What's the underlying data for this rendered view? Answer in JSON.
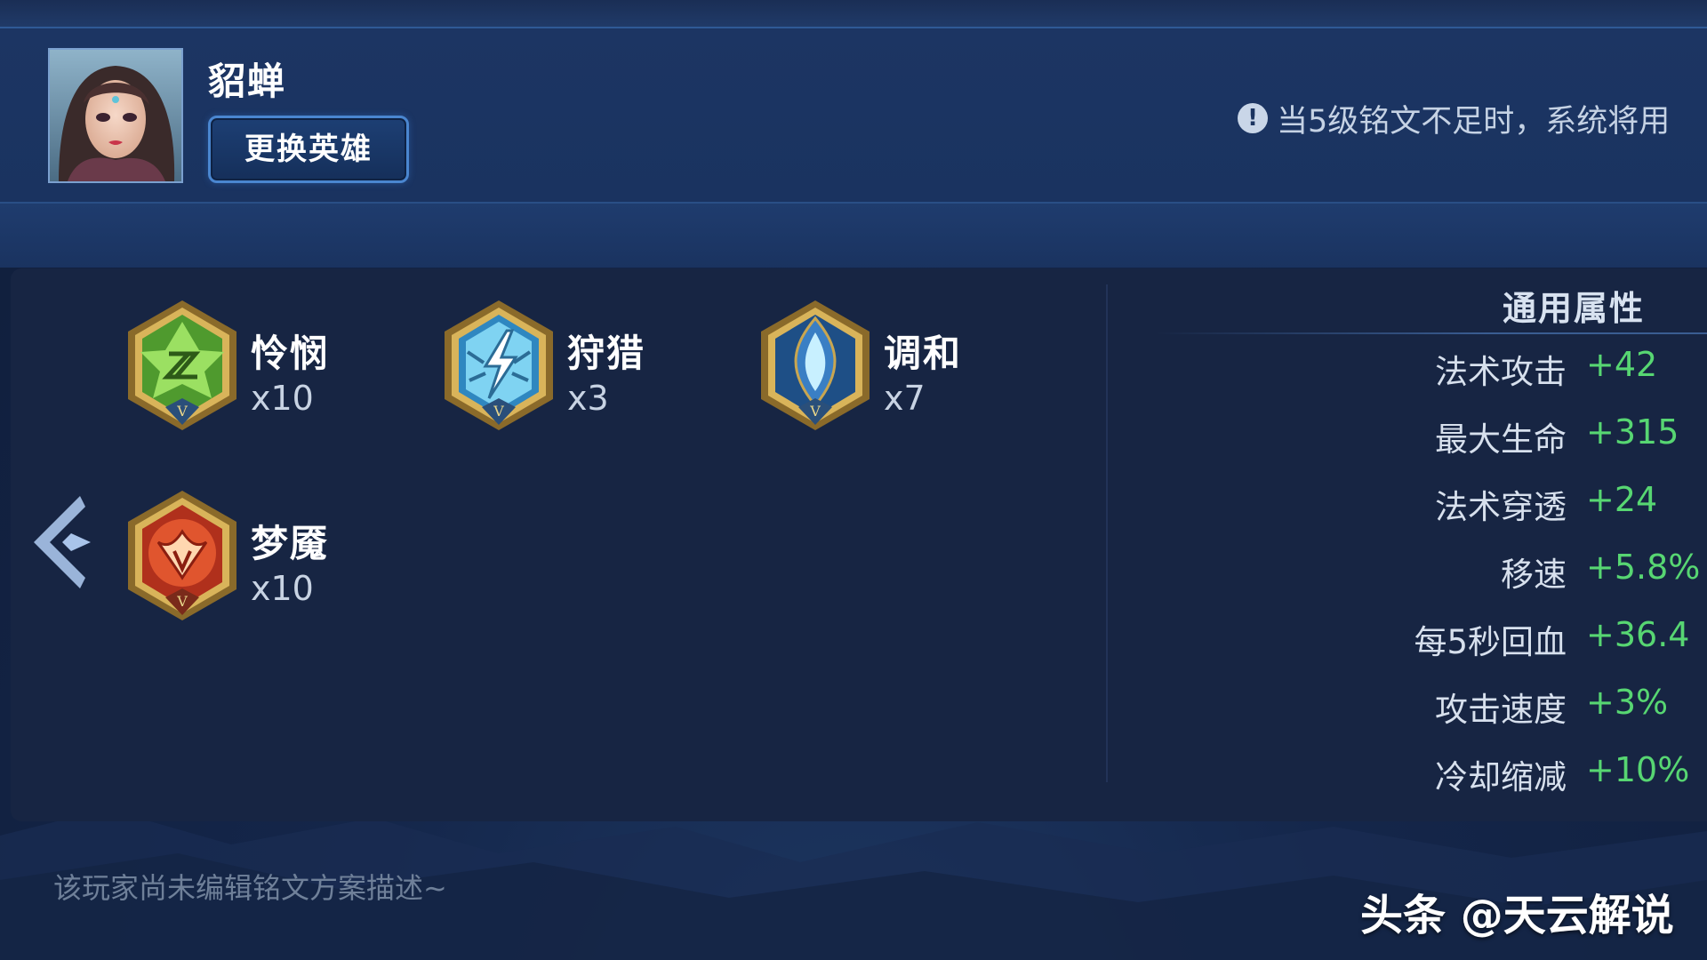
{
  "hero": {
    "name": "貂蝉",
    "change_button_label": "更换英雄"
  },
  "notice": {
    "icon": "exclamation-icon",
    "text": "当5级铭文不足时，系统将用"
  },
  "runes": [
    {
      "name": "怜悯",
      "count": "x10",
      "color": "#6cc24a",
      "icon": "green-rune-icon"
    },
    {
      "name": "狩猎",
      "count": "x3",
      "color": "#3aa7d8",
      "icon": "blue-rune-icon"
    },
    {
      "name": "调和",
      "count": "x7",
      "color": "#3a7fc4",
      "icon": "blue-rune-icon"
    },
    {
      "name": "梦魇",
      "count": "x10",
      "color": "#d7462a",
      "icon": "red-rune-icon"
    }
  ],
  "attributes": {
    "title": "通用属性",
    "items": [
      {
        "label": "法术攻击",
        "value": "+42"
      },
      {
        "label": "最大生命",
        "value": "+315"
      },
      {
        "label": "法术穿透",
        "value": "+24"
      },
      {
        "label": "移速",
        "value": "+5.8%"
      },
      {
        "label": "每5秒回血",
        "value": "+36.4"
      },
      {
        "label": "攻击速度",
        "value": "+3%"
      },
      {
        "label": "冷却缩减",
        "value": "+10%"
      }
    ]
  },
  "description": "该玩家尚未编辑铭文方案描述~",
  "watermark": "头条 @天云解说",
  "colors": {
    "value_green": "#57d672",
    "accent_blue": "#4a86d0",
    "panel": "#172543"
  }
}
